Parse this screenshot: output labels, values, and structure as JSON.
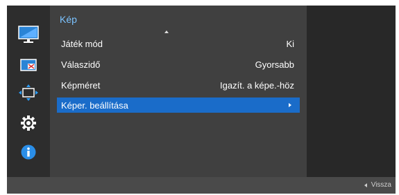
{
  "sidebar": {
    "icons": [
      "picture-icon",
      "pip-icon",
      "position-size-icon",
      "gear-icon",
      "info-icon"
    ],
    "active": "picture-icon"
  },
  "menu": {
    "title": "Kép",
    "items": [
      {
        "label": "Játék mód",
        "value": "Ki"
      },
      {
        "label": "Válaszidő",
        "value": "Gyorsabb"
      },
      {
        "label": "Képméret",
        "value": "Igazít. a képe.-höz"
      },
      {
        "label": "Képer. beállítása",
        "value": ""
      }
    ],
    "selected_index": 3
  },
  "footer": {
    "back_label": "Vissza"
  },
  "colors": {
    "accent": "#1a6cc9",
    "title": "#7bc3ff",
    "osd_bg": "#2b2b2b",
    "menu_bg": "#404040"
  }
}
